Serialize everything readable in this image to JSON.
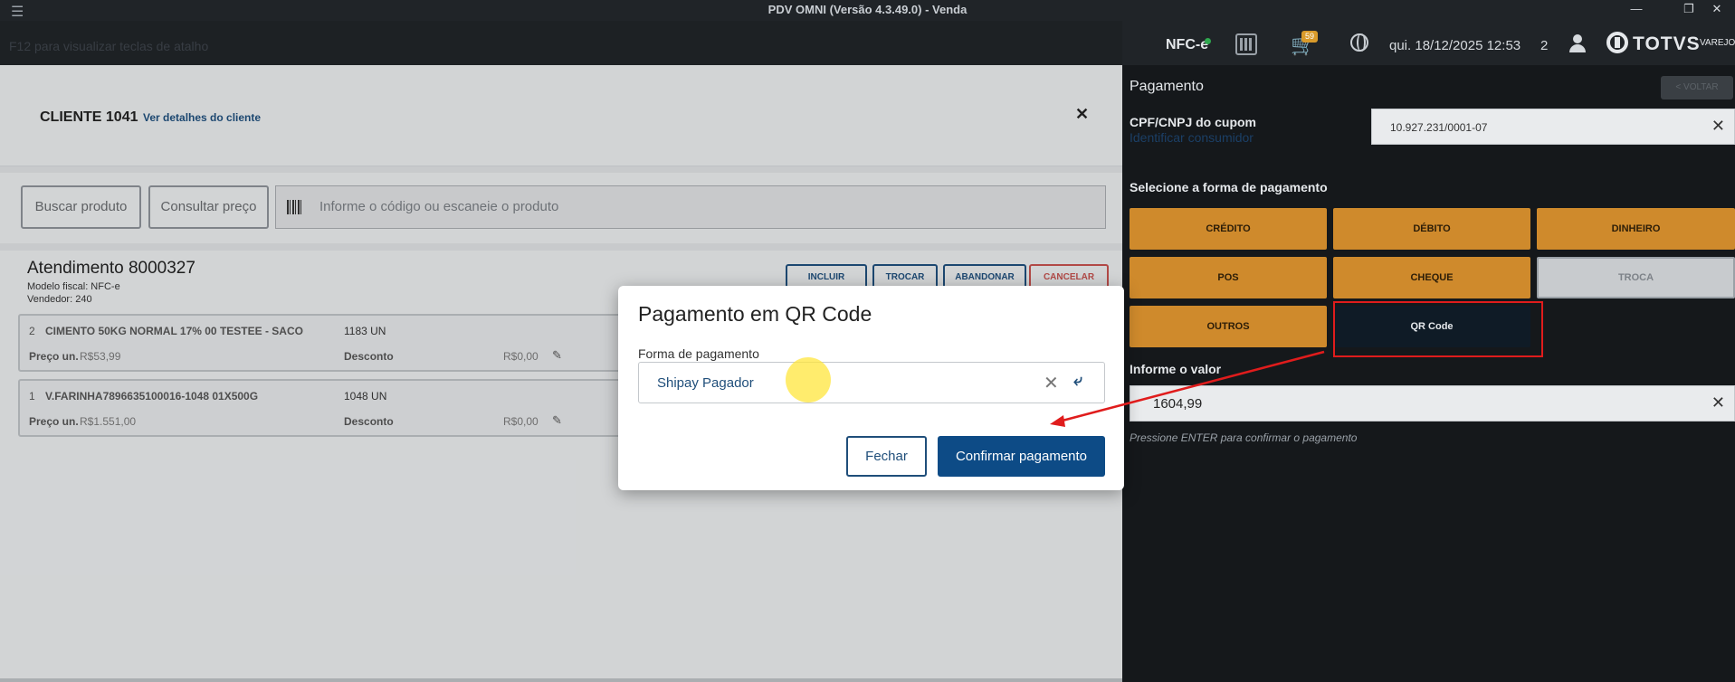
{
  "window": {
    "title": "PDV OMNI (Versão 4.3.49.0) - Venda",
    "minimize": "—",
    "maximize": "❐",
    "close": "✕"
  },
  "topbar": {
    "hint": "F12 para visualizar teclas de atalho",
    "doc_type": "NFC-e",
    "cart_count": "59",
    "datetime": "qui. 18/12/2025 12:53",
    "user_count": "2",
    "brand": "TOTVS",
    "brand_sub": "VAREJO"
  },
  "cliente": {
    "label": "CLIENTE 1041",
    "details_link": "Ver detalhes do cliente",
    "close": "✕"
  },
  "search": {
    "buscar_label": "Buscar produto",
    "consultar_label": "Consultar preço",
    "placeholder": "Informe o código ou escaneie o produto"
  },
  "atendimento": {
    "title": "Atendimento 8000327",
    "modelo": "Modelo fiscal: NFC-e",
    "vendedor": "Vendedor: 240",
    "actions": {
      "incluir": "INCLUIR",
      "trocar": "TROCAR",
      "abandonar": "ABANDONAR",
      "cancelar": "CANCELAR"
    },
    "items": [
      {
        "idx": "2",
        "name": "CIMENTO 50KG NORMAL 17% 00 TESTEE - SACO",
        "qty": "1183  UN",
        "price_label": "Preço un.",
        "price": "R$53,99",
        "discount_label": "Desconto",
        "discount": "R$0,00"
      },
      {
        "idx": "1",
        "name": "V.FARINHA7896635100016-1048 01X500G",
        "qty": "1048  UN",
        "price_label": "Preço un.",
        "price": "R$1.551,00",
        "discount_label": "Desconto",
        "discount": "R$0,00"
      }
    ]
  },
  "pagamento": {
    "title": "Pagamento",
    "voltar": "< VOLTAR",
    "cpf_label": "CPF/CNPJ do cupom",
    "identificar": "Identificar consumidor",
    "cpf_value": "10.927.231/0001-07",
    "select_label": "Selecione a forma de pagamento",
    "methods": {
      "credito": "CRÉDITO",
      "debito": "DÉBITO",
      "dinheiro": "DINHEIRO",
      "pos": "POS",
      "cheque": "CHEQUE",
      "troca": "TROCA",
      "outros": "OUTROS",
      "qr": "QR Code"
    },
    "valor_label": "Informe o valor",
    "valor": "1604,99",
    "enter_hint": "Pressione ENTER para confirmar o pagamento",
    "clear": "✕"
  },
  "modal": {
    "title": "Pagamento em QR Code",
    "field_label": "Forma de pagamento",
    "field_value": "Shipay Pagador",
    "clear": "✕",
    "chevron": "⤶",
    "fechar": "Fechar",
    "confirmar": "Confirmar pagamento"
  },
  "colors": {
    "accent": "#0d4b86",
    "payment_orange": "#cf8a2c",
    "highlight_red": "#e01c1c"
  }
}
